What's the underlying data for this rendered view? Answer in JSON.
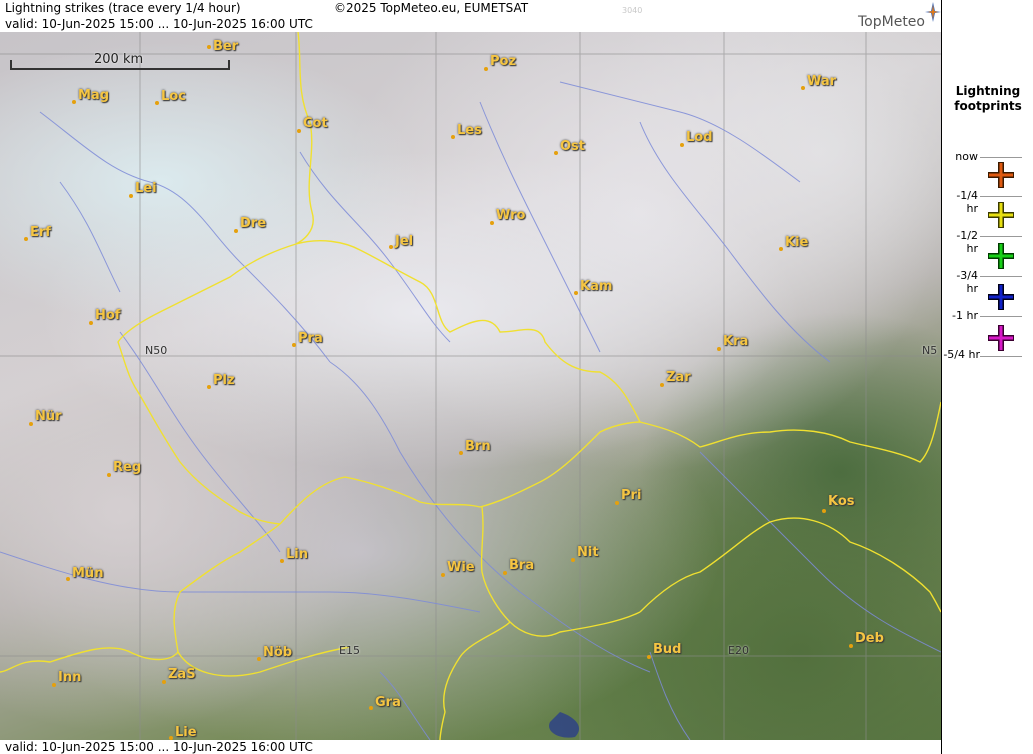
{
  "header": {
    "title": "Lightning strikes (trace every 1/4 hour)",
    "copyright": "©2025 TopMeteo.eu, EUMETSAT",
    "code": "3040",
    "valid": "valid:  10-Jun-2025 15:00 ... 10-Jun-2025 16:00 UTC",
    "brand": "TopMeteo"
  },
  "footer": {
    "valid": "valid:  10-Jun-2025 15:00 ... 10-Jun-2025 16:00 UTC"
  },
  "map": {
    "scale_label": "200 km",
    "grid_labels": {
      "n50_left": "N50",
      "n50_right": "N5",
      "e15": "E15",
      "e20": "E20"
    },
    "cities": [
      {
        "id": "ber",
        "label": "Ber"
      },
      {
        "id": "poz",
        "label": "Poz"
      },
      {
        "id": "war",
        "label": "War"
      },
      {
        "id": "mag",
        "label": "Mag"
      },
      {
        "id": "loc",
        "label": "Loc"
      },
      {
        "id": "cot",
        "label": "Cot"
      },
      {
        "id": "les",
        "label": "Les"
      },
      {
        "id": "ost",
        "label": "Ost"
      },
      {
        "id": "lod",
        "label": "Lod"
      },
      {
        "id": "lei",
        "label": "Lei"
      },
      {
        "id": "dre",
        "label": "Dre"
      },
      {
        "id": "wro",
        "label": "Wro"
      },
      {
        "id": "erf",
        "label": "Erf"
      },
      {
        "id": "jel",
        "label": "Jel"
      },
      {
        "id": "kie",
        "label": "Kie"
      },
      {
        "id": "kam",
        "label": "Kam"
      },
      {
        "id": "hof",
        "label": "Hof"
      },
      {
        "id": "pra",
        "label": "Pra"
      },
      {
        "id": "kra",
        "label": "Kra"
      },
      {
        "id": "plz",
        "label": "Plz"
      },
      {
        "id": "zar",
        "label": "Zar"
      },
      {
        "id": "nur",
        "label": "Nür"
      },
      {
        "id": "brn",
        "label": "Brn"
      },
      {
        "id": "reg",
        "label": "Reg"
      },
      {
        "id": "pri",
        "label": "Pri"
      },
      {
        "id": "kos",
        "label": "Kos"
      },
      {
        "id": "lin",
        "label": "Lin"
      },
      {
        "id": "nit",
        "label": "Nit"
      },
      {
        "id": "mun",
        "label": "Mün"
      },
      {
        "id": "wie",
        "label": "Wie"
      },
      {
        "id": "bra",
        "label": "Bra"
      },
      {
        "id": "nob",
        "label": "Nöb"
      },
      {
        "id": "bud",
        "label": "Bud"
      },
      {
        "id": "deb",
        "label": "Deb"
      },
      {
        "id": "inn",
        "label": "Inn"
      },
      {
        "id": "zas",
        "label": "ZaS"
      },
      {
        "id": "gra",
        "label": "Gra"
      },
      {
        "id": "lie",
        "label": "Lie"
      }
    ]
  },
  "legend": {
    "title_line1": "Lightning",
    "title_line2": "footprints",
    "items": [
      {
        "label": "now",
        "color": "#e05a10"
      },
      {
        "label": "-1/4 hr",
        "color": "#e8e010"
      },
      {
        "label": "-1/2 hr",
        "color": "#18d018"
      },
      {
        "label": "-3/4 hr",
        "color": "#1020c8"
      },
      {
        "label": "-1 hr",
        "color": "#d818c8"
      },
      {
        "label": "-5/4 hr",
        "color": ""
      }
    ]
  }
}
